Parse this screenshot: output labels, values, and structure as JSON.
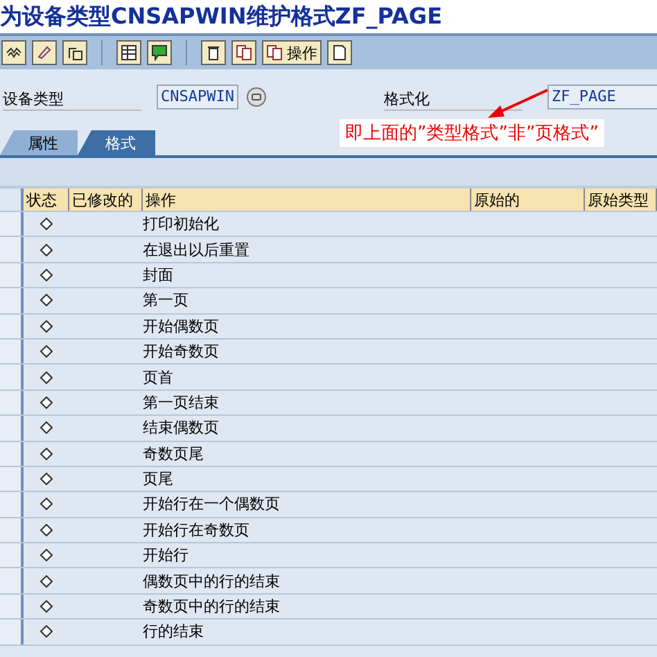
{
  "window": {
    "title": "为设备类型CNSAPWIN维护格式ZF_PAGE"
  },
  "toolbar": {
    "action_button": "操作"
  },
  "fields": [
    {
      "label": "设备类型",
      "value": "CNSAPWIN"
    },
    {
      "label": "格式化",
      "value": "ZF_PAGE"
    }
  ],
  "annotation": {
    "text": "即上面的”类型格式”非”页格式”"
  },
  "tabs": [
    {
      "label": "属性",
      "selected": false
    },
    {
      "label": "格式",
      "selected": true
    }
  ],
  "table": {
    "columns": [
      "状态",
      "已修改的",
      "操作",
      "原始的",
      "原始类型"
    ],
    "rows": [
      {
        "operation": "打印初始化"
      },
      {
        "operation": "在退出以后重置"
      },
      {
        "operation": "封面"
      },
      {
        "operation": "第一页"
      },
      {
        "operation": "开始偶数页"
      },
      {
        "operation": "开始奇数页"
      },
      {
        "operation": "页首"
      },
      {
        "operation": "第一页结束"
      },
      {
        "operation": "结束偶数页"
      },
      {
        "operation": "奇数页尾"
      },
      {
        "operation": "页尾"
      },
      {
        "operation": "开始行在一个偶数页"
      },
      {
        "operation": "开始行在奇数页"
      },
      {
        "operation": "开始行"
      },
      {
        "operation": "偶数页中的行的结束"
      },
      {
        "operation": "奇数页中的行的结束"
      },
      {
        "operation": "行的结束"
      }
    ]
  }
}
